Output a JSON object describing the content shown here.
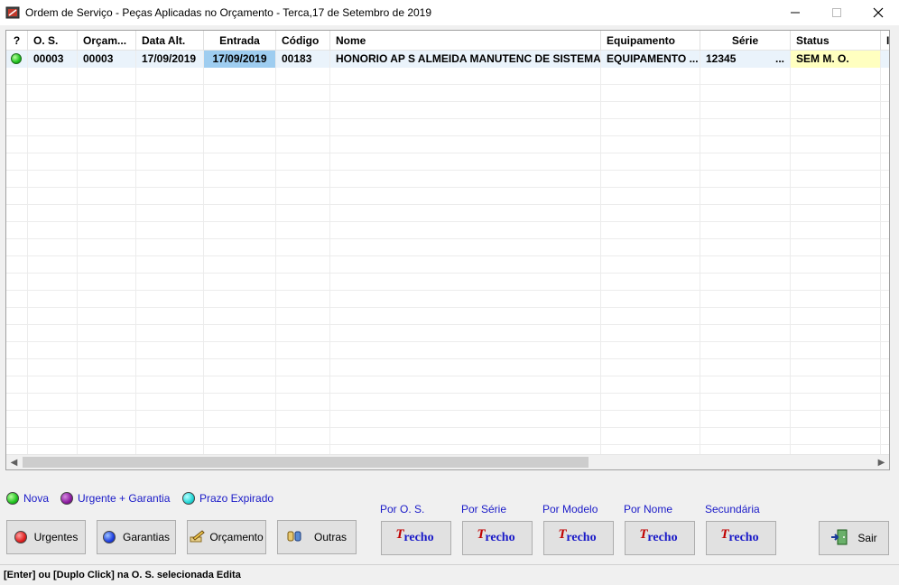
{
  "window": {
    "title": "Ordem de Serviço - Peças Aplicadas no Orçamento - Terca,17 de Setembro de 2019",
    "minimize": "—",
    "maximize": "☐",
    "close": "✕"
  },
  "grid": {
    "columns": [
      "?",
      "O. S.",
      "Orçam...",
      "Data Alt.",
      "Entrada",
      "Código",
      "Nome",
      "Equipamento",
      "Série",
      "Status",
      "I"
    ],
    "rows": [
      {
        "status_dot": "green",
        "os": "00003",
        "orcamento": "00003",
        "data_alt": "17/09/2019",
        "entrada": "17/09/2019",
        "codigo": "00183",
        "nome": "HONORIO AP S ALMEIDA MANUTENC DE SISTEMA...",
        "equipamento": "EQUIPAMENTO  ...",
        "serie": "12345",
        "serie_more": "...",
        "status": "SEM M. O."
      }
    ]
  },
  "legend": {
    "nova": "Nova",
    "urgente_garantia": "Urgente + Garantia",
    "prazo_expirado": "Prazo Expirado"
  },
  "buttons": {
    "urgentes": "Urgentes",
    "garantias": "Garantias",
    "orcamento": "Orçamento",
    "outras": "Outras",
    "sair": "Sair"
  },
  "trecho": {
    "por_os": "Por O. S.",
    "por_serie": "Por Série",
    "por_modelo": "Por Modelo",
    "por_nome": "Por Nome",
    "secundaria": "Secundária",
    "button_text": "recho"
  },
  "statusbar": "[Enter] ou [Duplo Click] na O. S. selecionada Edita",
  "colors": {
    "legend_text": "#1a1ac8",
    "selected_cell": "#9ecdf0",
    "status_yellow": "#ffffc0"
  }
}
